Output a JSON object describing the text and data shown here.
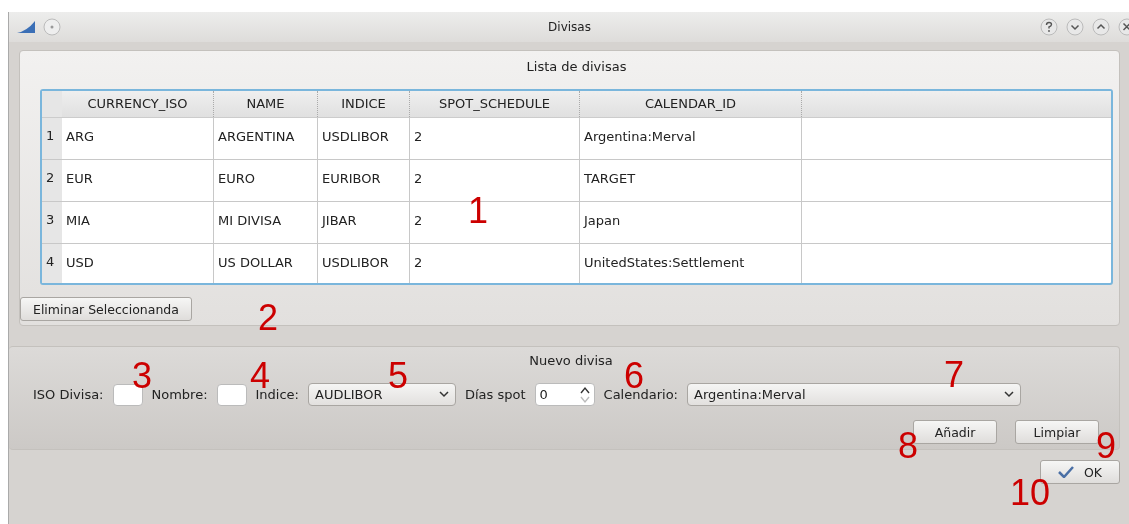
{
  "window": {
    "title": "Divisas"
  },
  "list_group": {
    "title": "Lista de divisas",
    "table": {
      "columns": [
        "CURRENCY_ISO",
        "NAME",
        "INDICE",
        "SPOT_SCHEDULE",
        "CALENDAR_ID"
      ],
      "rows": [
        {
          "number": "1",
          "cells": [
            "ARG",
            "ARGENTINA",
            "USDLIBOR",
            "2",
            "Argentina:Merval"
          ]
        },
        {
          "number": "2",
          "cells": [
            "EUR",
            "EURO",
            "EURIBOR",
            "2",
            "TARGET"
          ]
        },
        {
          "number": "3",
          "cells": [
            "MIA",
            "MI DIVISA",
            "JIBAR",
            "2",
            "Japan"
          ]
        },
        {
          "number": "4",
          "cells": [
            "USD",
            "US DOLLAR",
            "USDLIBOR",
            "2",
            "UnitedStates:Settlement"
          ]
        }
      ]
    },
    "delete_button": "Eliminar Seleccionanda"
  },
  "new_group": {
    "title": "Nuevo divisa",
    "iso_label": "ISO Divisa:",
    "name_label": "Nombre:",
    "index_label": "Indice:",
    "index_value": "AUDLIBOR",
    "spot_label": "Días spot",
    "spot_value": "0",
    "calendar_label": "Calendario:",
    "calendar_value": "Argentina:Merval",
    "add_button": "Añadir",
    "clear_button": "Limpiar"
  },
  "ok_button": "OK",
  "annotations": [
    "1",
    "2",
    "3",
    "4",
    "5",
    "6",
    "7",
    "8",
    "9",
    "10"
  ]
}
